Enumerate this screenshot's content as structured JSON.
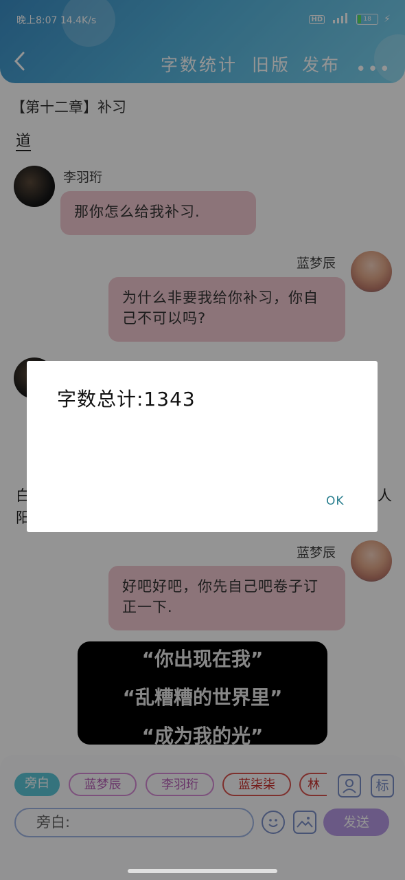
{
  "status_bar": {
    "time_speed": "晚上8:07 14.4K/s",
    "network": "HD",
    "battery": "18",
    "battery_level_percent": 18
  },
  "header": {
    "back_icon": "chevron-left-icon",
    "nav_items": [
      "字数统计",
      "旧版",
      "发布"
    ],
    "more_icon": "more-dots-icon",
    "gradient_colors": [
      "#3b8fc7",
      "#7dd3ee"
    ]
  },
  "chat": {
    "chapter_title": "【第十二章】补习",
    "first_char": "道",
    "messages": [
      {
        "speaker": "李羽珩",
        "side": "left",
        "text": "那你怎么给我补习."
      },
      {
        "speaker": "蓝梦辰",
        "side": "right",
        "text": "为什么非要我给你补习，你自己不可以吗?"
      },
      {
        "speaker": "蓝梦辰",
        "side": "right",
        "text": "好吧好吧，你先自己吧卷子订正一下."
      }
    ],
    "fragments": {
      "left_a": "白",
      "left_b": "阳",
      "right_a": "人"
    },
    "bubble_color": "#f2c9d0"
  },
  "dialog": {
    "message": "字数总计:1343",
    "ok_label": "OK"
  },
  "lyrics": {
    "lines": [
      "“你出现在我”",
      "“乱糟糟的世界里”",
      "“成为我的光”"
    ]
  },
  "composer": {
    "chips": [
      {
        "label": "旁白",
        "selected": true
      },
      {
        "label": "蓝梦辰",
        "selected": false
      },
      {
        "label": "李羽珩",
        "selected": false
      },
      {
        "label": "蓝柒柒",
        "selected": false
      },
      {
        "label": "林",
        "selected": false
      }
    ],
    "person_icon": "person-icon",
    "tag_icon_label": "标",
    "input_value": "旁白:",
    "emoji_icon": "emoji-icon",
    "image_icon": "image-icon",
    "send_label": "发送",
    "accent": "#b79ae6"
  }
}
